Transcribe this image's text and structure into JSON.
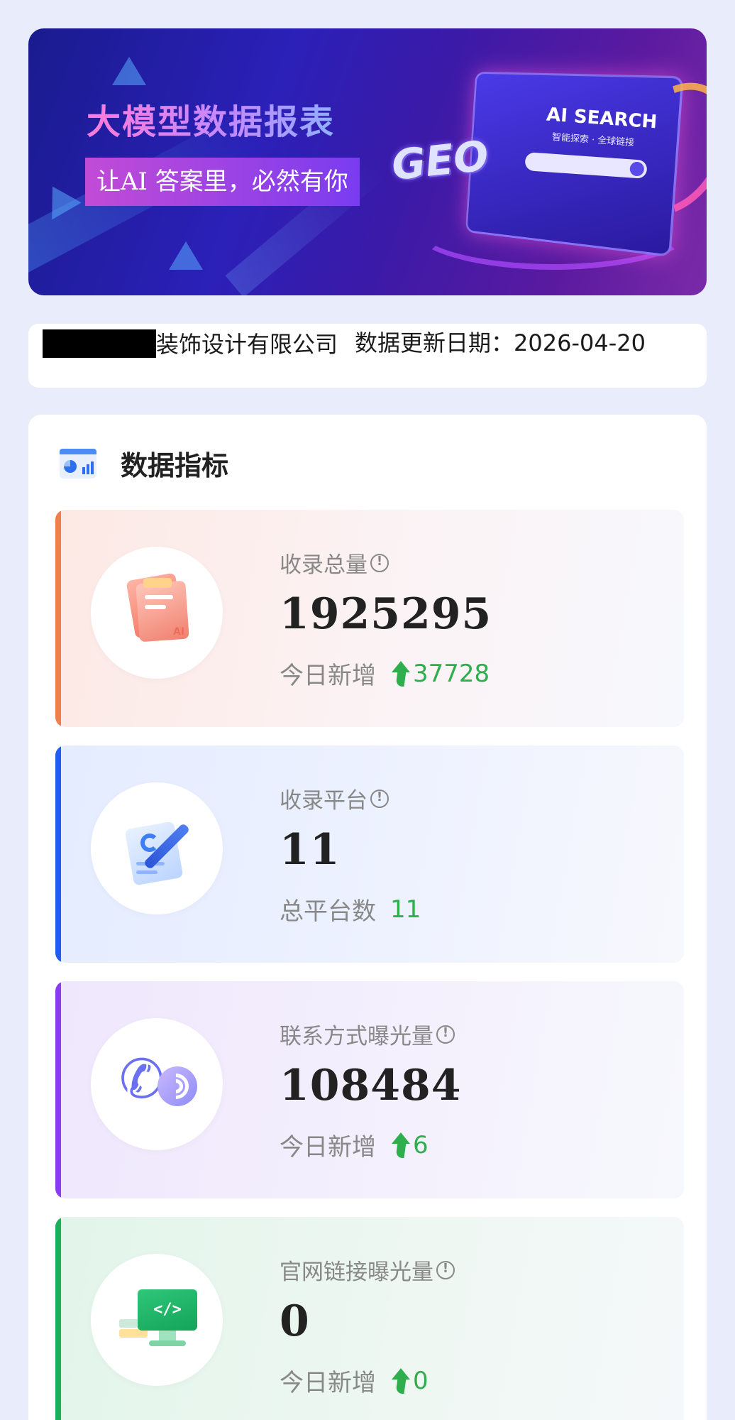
{
  "banner": {
    "title": "大模型数据报表",
    "subtitle": "让AI 答案里，必然有你",
    "badge": "GEO",
    "screen_title": "AI SEARCH",
    "screen_subtitle": "智能探索 · 全球链接"
  },
  "company": {
    "name": "装饰设计有限公司",
    "date_label": "数据更新日期：",
    "date": "2026-04-20"
  },
  "metrics": {
    "title": "数据指标",
    "items": [
      {
        "label": "收录总量",
        "value": "1925295",
        "sub_label": "今日新增",
        "sub_value": "37728",
        "trend": "up",
        "accent": "#f27e4a"
      },
      {
        "label": "收录平台",
        "value": "11",
        "sub_label": "总平台数",
        "sub_value": "11",
        "trend": "none",
        "accent": "#1f5ef0"
      },
      {
        "label": "联系方式曝光量",
        "value": "108484",
        "sub_label": "今日新增",
        "sub_value": "6",
        "trend": "up",
        "accent": "#8a3cf0"
      },
      {
        "label": "官网链接曝光量",
        "value": "0",
        "sub_label": "今日新增",
        "sub_value": "0",
        "trend": "up",
        "accent": "#19b05a"
      }
    ]
  },
  "colors": {
    "positive": "#2fae4e",
    "background": "#e8ecfb"
  }
}
